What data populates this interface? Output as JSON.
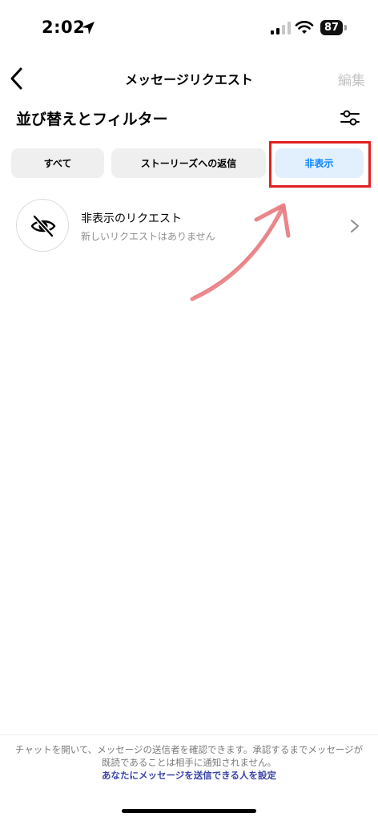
{
  "status_bar": {
    "time": "2:02",
    "battery": "87"
  },
  "nav": {
    "title": "メッセージリクエスト",
    "edit": "編集"
  },
  "section": {
    "title": "並び替えとフィルター"
  },
  "chips": {
    "all": "すべて",
    "stories": "ストーリーズへの返信",
    "hidden": "非表示"
  },
  "request_row": {
    "title": "非表示のリクエスト",
    "subtitle": "新しいリクエストはありません"
  },
  "footer": {
    "text": "チャットを開いて、メッセージの送信者を確認できます。承認するまでメッセージが既読であることは相手に通知されません。",
    "link": "あなたにメッセージを送信できる人を設定"
  },
  "colors": {
    "accent": "#0a84ff",
    "chip_bg": "#efefef",
    "chip_selected_bg": "#e2f0fd",
    "highlight": "#e02020",
    "annotation_arrow": "#e8787c",
    "link": "#3b45a8"
  },
  "icons": [
    "location-arrow-icon",
    "cellular-signal-icon",
    "wifi-icon",
    "battery-icon",
    "back-chevron-icon",
    "filter-sliders-icon",
    "eye-slash-icon",
    "chevron-right-icon"
  ]
}
